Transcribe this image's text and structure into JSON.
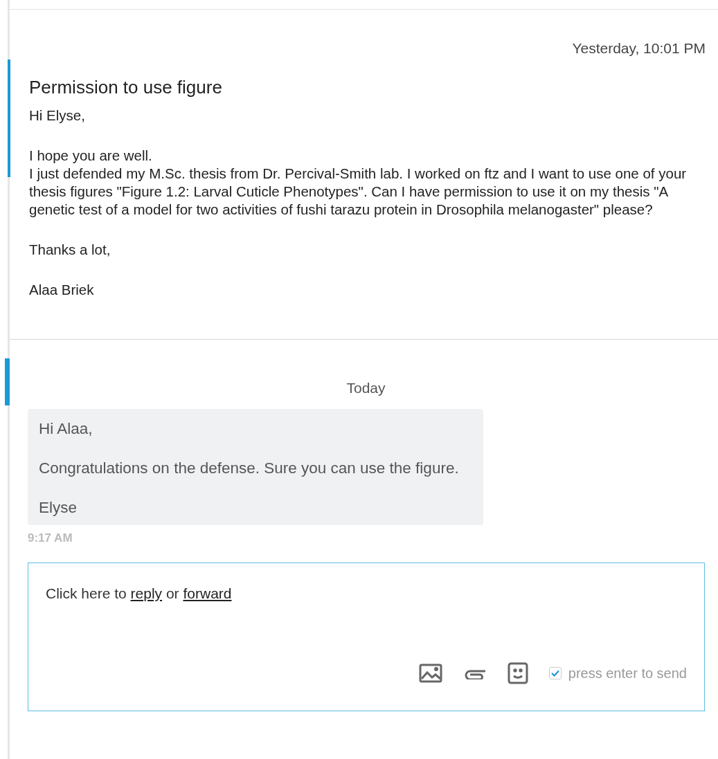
{
  "message": {
    "time": "Yesterday, 10:01 PM",
    "subject": "Permission to use figure",
    "paragraphs": [
      [
        "Hi Elyse,"
      ],
      [
        "I hope you are well.",
        "I just defended my M.Sc. thesis from Dr. Percival-Smith lab. I worked on ftz and I want to use one of your thesis figures \"Figure 1.2: Larval Cuticle Phenotypes\". Can I have permission to use it on my thesis \"A genetic test of a model for two activities of fushi tarazu protein in Drosophila melanogaster\" please?"
      ],
      [
        "Thanks a lot,"
      ],
      [
        "Alaa Briek"
      ]
    ]
  },
  "day_label": "Today",
  "reply": {
    "paragraphs": [
      "Hi Alaa,",
      "Congratulations on the defense. Sure you can use the figure.",
      "Elyse"
    ],
    "time": "9:17 AM"
  },
  "composer": {
    "prompt": "Click here to",
    "reply_link": "reply",
    "or_text": "or",
    "forward_link": "forward",
    "send_on_enter": {
      "label": "press enter to send",
      "checked": true
    }
  }
}
